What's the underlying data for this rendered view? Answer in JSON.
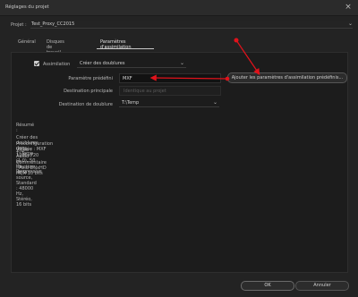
{
  "window": {
    "title": "Réglages du projet",
    "close_icon": "×"
  },
  "project": {
    "label": "Projet :",
    "value": "Test_Proxy_CC2015"
  },
  "tabs": [
    {
      "label": "Général",
      "active": false
    },
    {
      "label": "Disques de travail",
      "active": false
    },
    {
      "label": "Paramètres d'assimilation",
      "active": true
    }
  ],
  "assimilation": {
    "checkbox_label": "Assimilation",
    "checked": true,
    "mode_value": "Créer des doublures"
  },
  "preset": {
    "label": "Paramètre prédéfini",
    "value": "MXF",
    "add_button_label": "Ajouter les paramètres d'assimilation prédéfinis..."
  },
  "primary_destination": {
    "label": "Destination principale",
    "value": "Identique au projet"
  },
  "duplicate_destination": {
    "label": "Destination de doublure",
    "value": "T:\\Temp"
  },
  "summary": {
    "title": "Résumé :",
    "lines": [
      "Créer des doublures dans T:\\Temp",
      "Préconfiguration utilisée : MXF",
      "Vidéo : 1280x720 (1,0), 50 i/s, Progressive",
      "Audio : en fonction de la source, Standard : 48000 Hz, Stéréo, 16 bits",
      "Commentaire : Avid DNxHD HQX 10 bits"
    ]
  },
  "footer": {
    "ok_label": "OK",
    "cancel_label": "Annuler"
  },
  "annotation_colors": {
    "arrow": "#e1121b"
  }
}
